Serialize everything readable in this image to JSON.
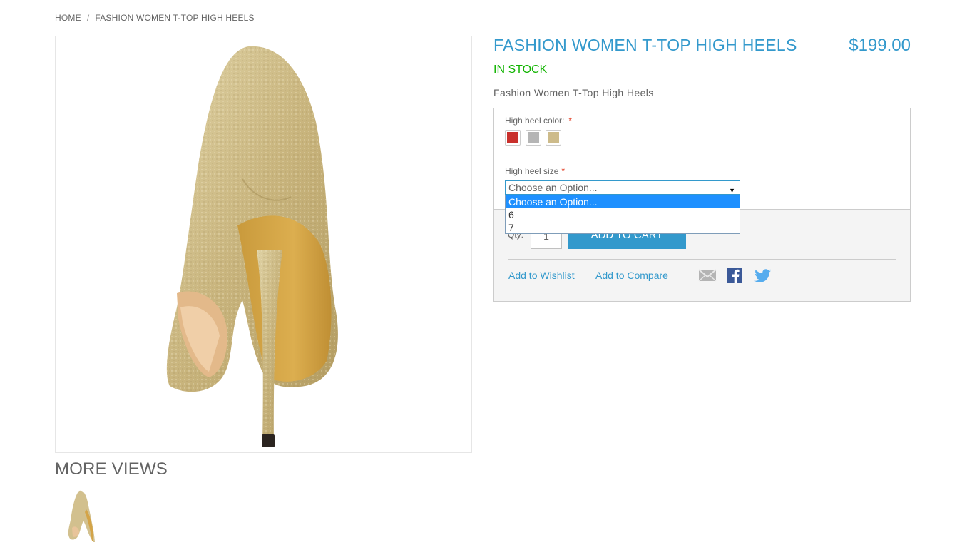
{
  "breadcrumb": {
    "home": "HOME",
    "separator": "/",
    "current": "FASHION WOMEN T-TOP HIGH HEELS"
  },
  "product": {
    "name": "FASHION WOMEN T-TOP HIGH HEELS",
    "price": "$199.00",
    "availability": "IN STOCK",
    "short_description": "Fashion Women T-Top High Heels"
  },
  "options": {
    "color_label": "High heel color:",
    "color_required": "*",
    "swatches": [
      {
        "name": "red",
        "color": "#c9302c"
      },
      {
        "name": "silver",
        "color": "#b5b5b5"
      },
      {
        "name": "gold",
        "color": "#cdbb8a"
      }
    ],
    "size_label": "High heel size",
    "size_required": "*",
    "size_selected": "Choose an Option...",
    "size_options": [
      "Choose an Option...",
      "6",
      "7"
    ]
  },
  "cart": {
    "qty_label": "Qty:",
    "qty_value": "1",
    "add_to_cart": "ADD TO CART"
  },
  "links": {
    "wishlist": "Add to Wishlist",
    "compare": "Add to Compare"
  },
  "share_icons": [
    "email-icon",
    "facebook-icon",
    "twitter-icon"
  ],
  "more_views": {
    "title": "MORE VIEWS"
  },
  "colors": {
    "accent": "#3399cc",
    "in_stock": "#11b400",
    "required": "#df280a",
    "dropdown_highlight": "#1e90ff"
  }
}
